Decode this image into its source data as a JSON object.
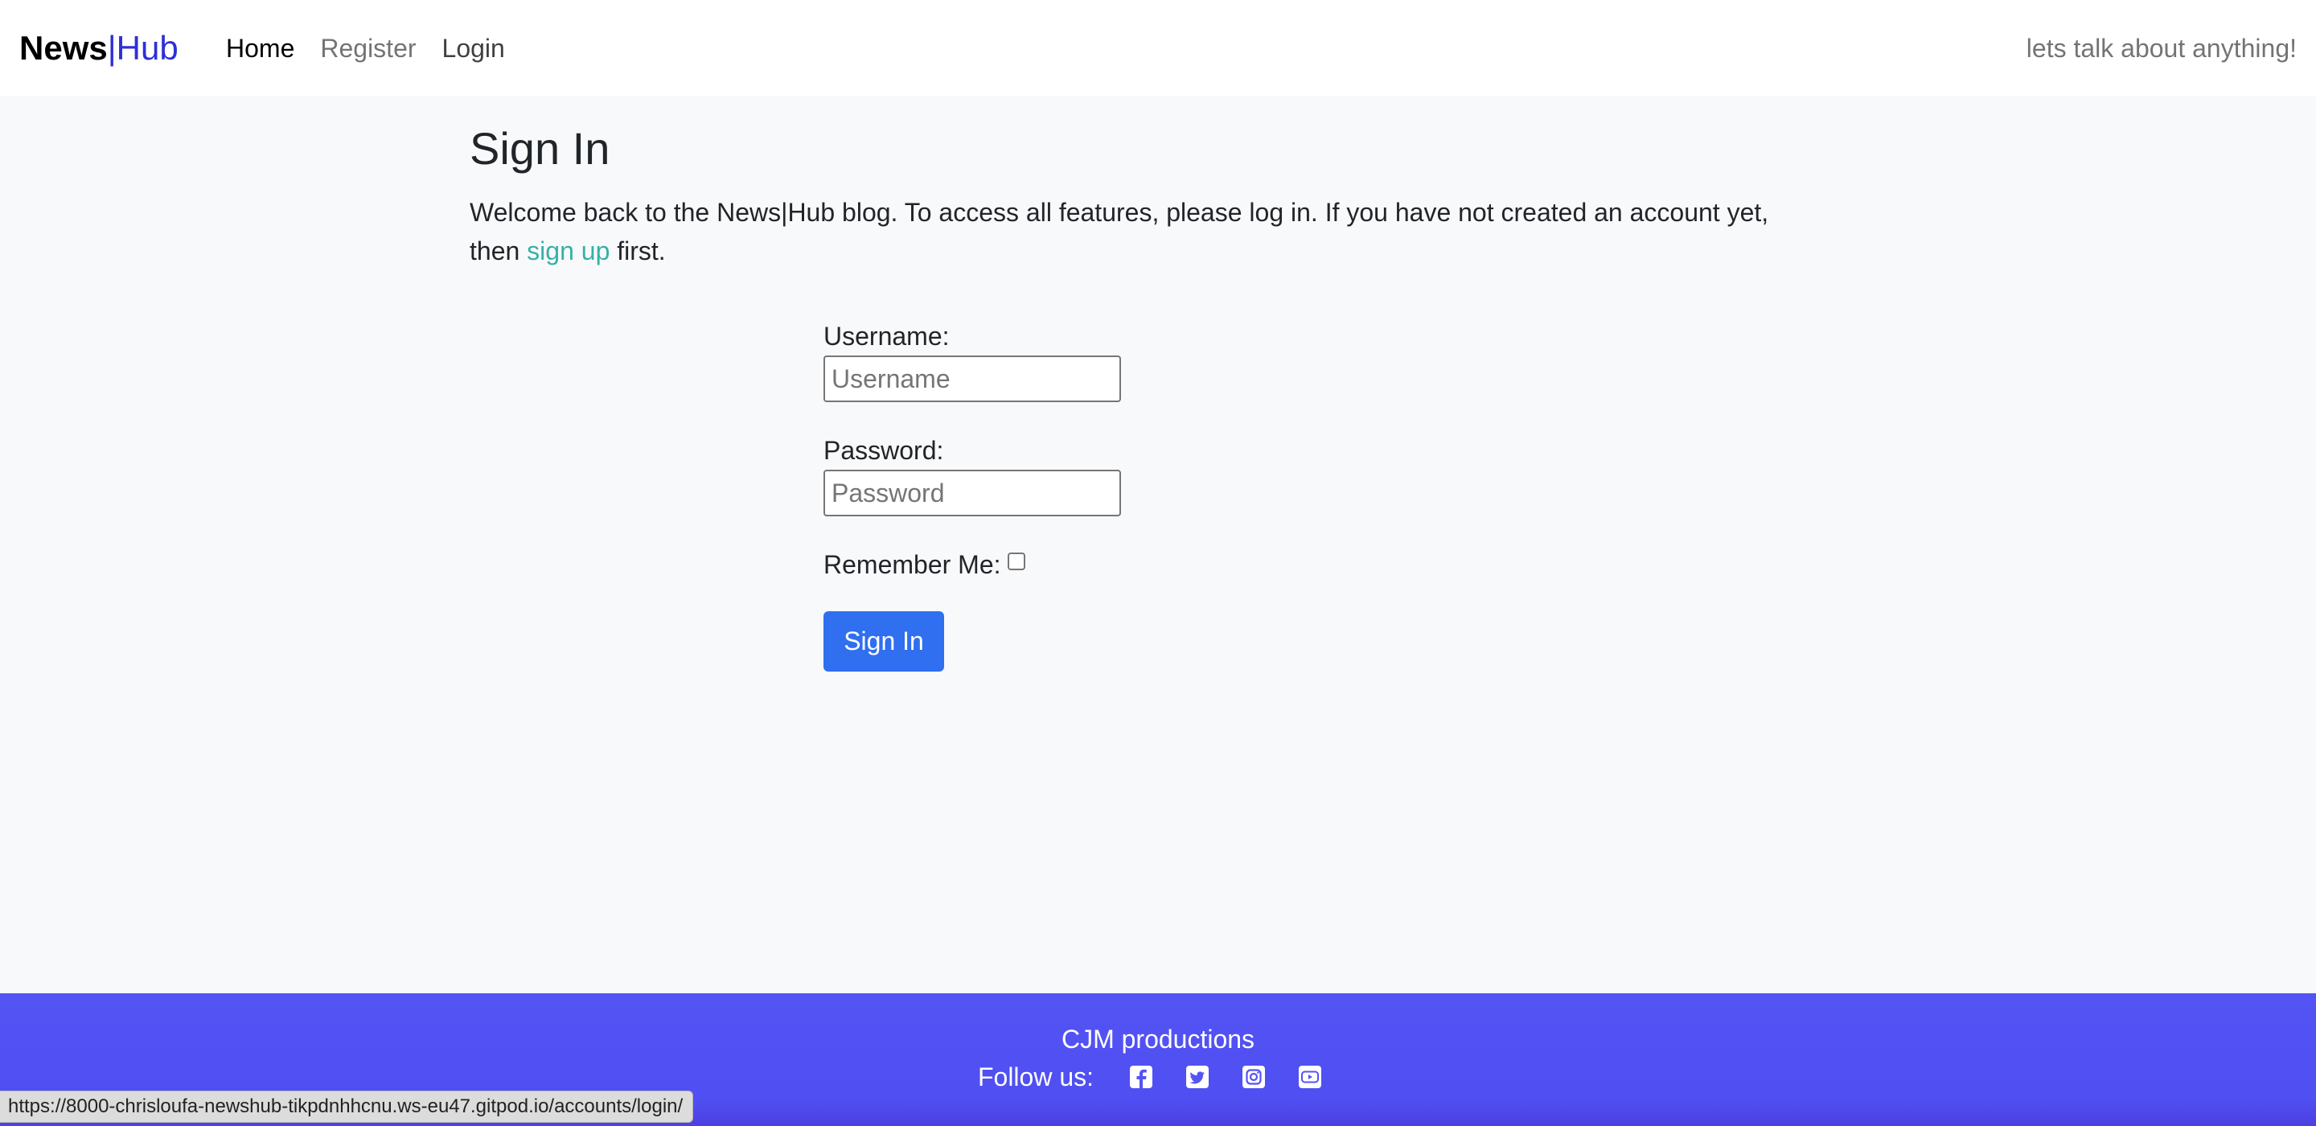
{
  "navbar": {
    "brand_news": "News",
    "brand_sep": "|",
    "brand_hub": "Hub",
    "links": [
      {
        "label": "Home"
      },
      {
        "label": "Register"
      },
      {
        "label": "Login"
      }
    ],
    "tagline": "lets talk about anything!"
  },
  "main": {
    "title": "Sign In",
    "intro_text": "Welcome back to the News|Hub blog. To access all features, please log in. If you have not created an account yet, then ",
    "signup_link": "sign up",
    "intro_end": " first."
  },
  "form": {
    "username_label": "Username:",
    "username_placeholder": "Username",
    "username_value": "",
    "password_label": "Password:",
    "password_placeholder": "Password",
    "password_value": "",
    "remember_label": "Remember Me:",
    "remember_checked": false,
    "submit_label": "Sign In"
  },
  "footer": {
    "credit": "CJM productions",
    "follow_label": "Follow us:",
    "social_icons": [
      "facebook-icon",
      "twitter-icon",
      "instagram-icon",
      "youtube-icon"
    ]
  },
  "status_bar": {
    "url": "https://8000-chrisloufa-newshub-tikpdnhhcnu.ws-eu47.gitpod.io/accounts/login/"
  },
  "colors": {
    "brand_accent": "#2f2fd6",
    "link": "#36b1a6",
    "primary_button": "#2f6ff0",
    "footer_bg": "#5454f5",
    "page_bg": "#f8f9fa"
  }
}
